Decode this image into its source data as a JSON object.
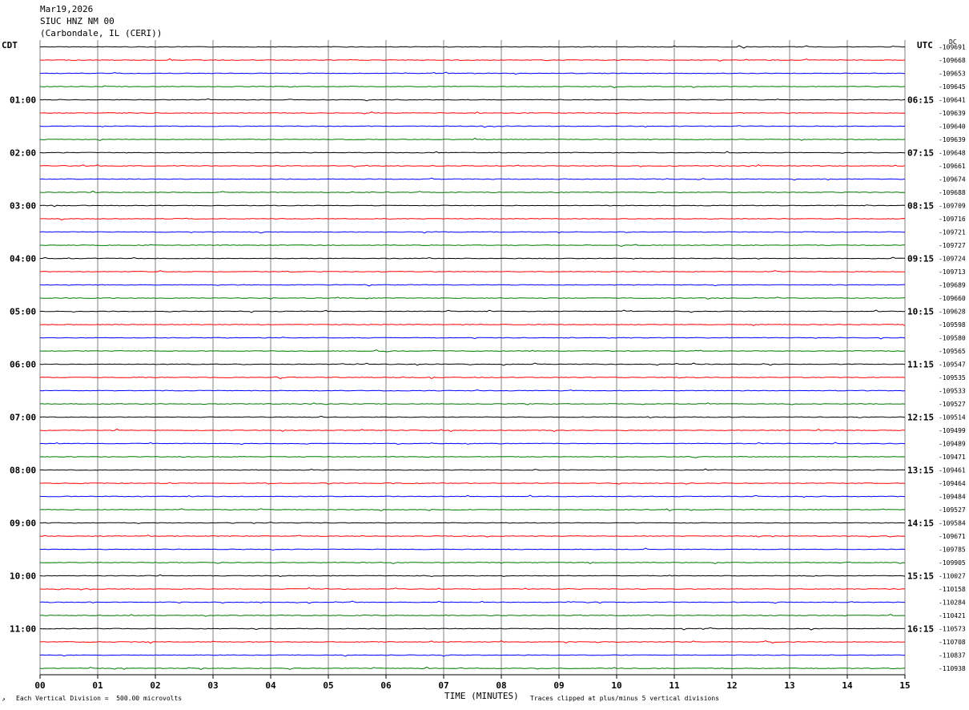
{
  "header": {
    "date": "Mar19,2026",
    "station": "SIUC HNZ NM 00",
    "location": "(Carbondale, IL (CERI))"
  },
  "left_axis_title": "CDT",
  "right_axis_title": "UTC",
  "dc_label": "DC",
  "footer": {
    "scale_mark": "↗",
    "scale_note": "Each Vertical Division =  500.00 microvolts",
    "clip_note": "Traces clipped at plus/minus 5 vertical divisions"
  },
  "colors": {
    "black": "#000000",
    "red": "#ff0000",
    "blue": "#0000ff",
    "green": "#007700",
    "grid": "#808080"
  },
  "chart_data": {
    "type": "line",
    "xlabel": "TIME (MINUTES)",
    "xlim": [
      0,
      15
    ],
    "x_ticks": [
      "00",
      "01",
      "02",
      "03",
      "04",
      "05",
      "06",
      "07",
      "08",
      "09",
      "10",
      "11",
      "12",
      "13",
      "14",
      "15"
    ],
    "left_hour_labels": [
      "01:00",
      "02:00",
      "03:00",
      "04:00",
      "05:00",
      "06:00",
      "07:00",
      "08:00",
      "09:00",
      "10:00",
      "11:00"
    ],
    "right_hour_labels": [
      "06:15",
      "07:15",
      "08:15",
      "09:15",
      "10:15",
      "11:15",
      "12:15",
      "13:15",
      "14:15",
      "15:15",
      "16:15"
    ],
    "trace_color_cycle": [
      "black",
      "red",
      "blue",
      "green"
    ],
    "dc_offsets": [
      "-109691",
      "-109668",
      "-109653",
      "-109645",
      "-109641",
      "-109639",
      "-109640",
      "-109639",
      "-109648",
      "-109661",
      "-109674",
      "-109688",
      "-109709",
      "-109716",
      "-109721",
      "-109727",
      "-109724",
      "-109713",
      "-109689",
      "-109660",
      "-109628",
      "-109598",
      "-109580",
      "-109565",
      "-109547",
      "-109535",
      "-109533",
      "-109527",
      "-109514",
      "-109499",
      "-109489",
      "-109471",
      "-109461",
      "-109464",
      "-109484",
      "-109527",
      "-109584",
      "-109671",
      "-109785",
      "-109905",
      "-110027",
      "-110158",
      "-110284",
      "-110421",
      "-110573",
      "-110708",
      "-110837",
      "-110938"
    ]
  }
}
